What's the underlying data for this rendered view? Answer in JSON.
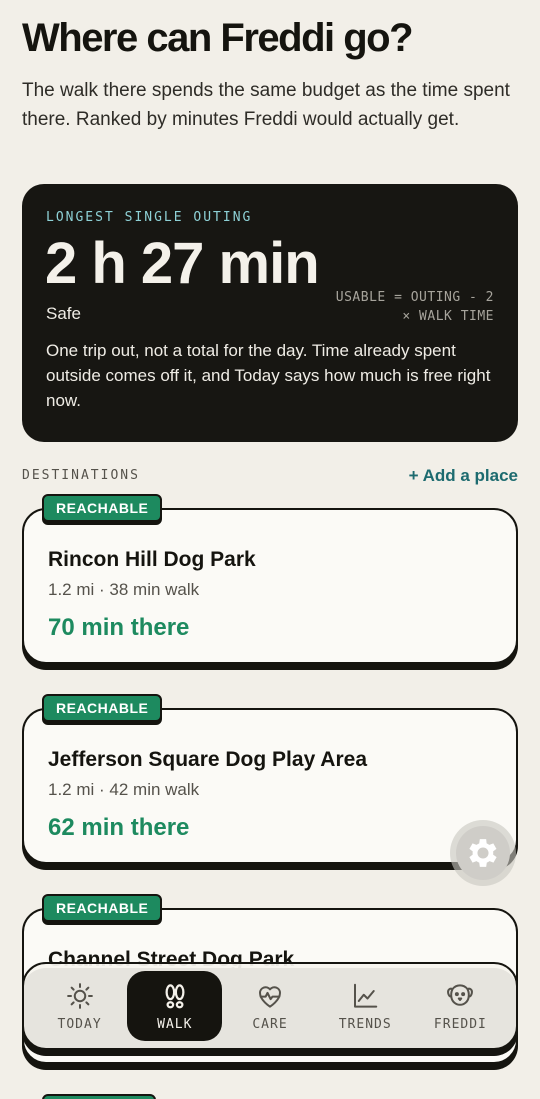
{
  "page": {
    "title": "Where can Freddi go?",
    "subtitle": "The walk there spends the same budget as the time spent there. Ranked by minutes Freddi would actually get."
  },
  "hero": {
    "label": "LONGEST SINGLE OUTING",
    "value": "2 h 27 min",
    "status": "Safe",
    "formula": "USABLE = OUTING - 2 × WALK TIME",
    "note": "One trip out, not a total for the day. Time already spent outside comes off it, and Today says how much is free right now."
  },
  "destinations": {
    "label": "DESTINATIONS",
    "add_label": "+ Add a place",
    "items": [
      {
        "badge": "REACHABLE",
        "name": "Rincon Hill Dog Park",
        "meta": "1.2 mi · 38 min walk",
        "time": "70 min there"
      },
      {
        "badge": "REACHABLE",
        "name": "Jefferson Square Dog Play Area",
        "meta": "1.2 mi · 42 min walk",
        "time": "62 min there"
      },
      {
        "badge": "REACHABLE",
        "name": "Channel Street Dog Park",
        "meta": "",
        "time": ""
      }
    ]
  },
  "nav": {
    "items": [
      {
        "label": "TODAY",
        "icon": "sun-icon"
      },
      {
        "label": "WALK",
        "icon": "paws-icon"
      },
      {
        "label": "CARE",
        "icon": "heart-pulse-icon"
      },
      {
        "label": "TRENDS",
        "icon": "chart-line-icon"
      },
      {
        "label": "FREDDI",
        "icon": "dog-face-icon"
      }
    ],
    "active": "WALK"
  },
  "colors": {
    "background": "#f2efe8",
    "accent_green": "#1d8a5f",
    "accent_teal": "#1d6b6f",
    "hero_label": "#8ed1d6",
    "dark": "#15140f"
  }
}
